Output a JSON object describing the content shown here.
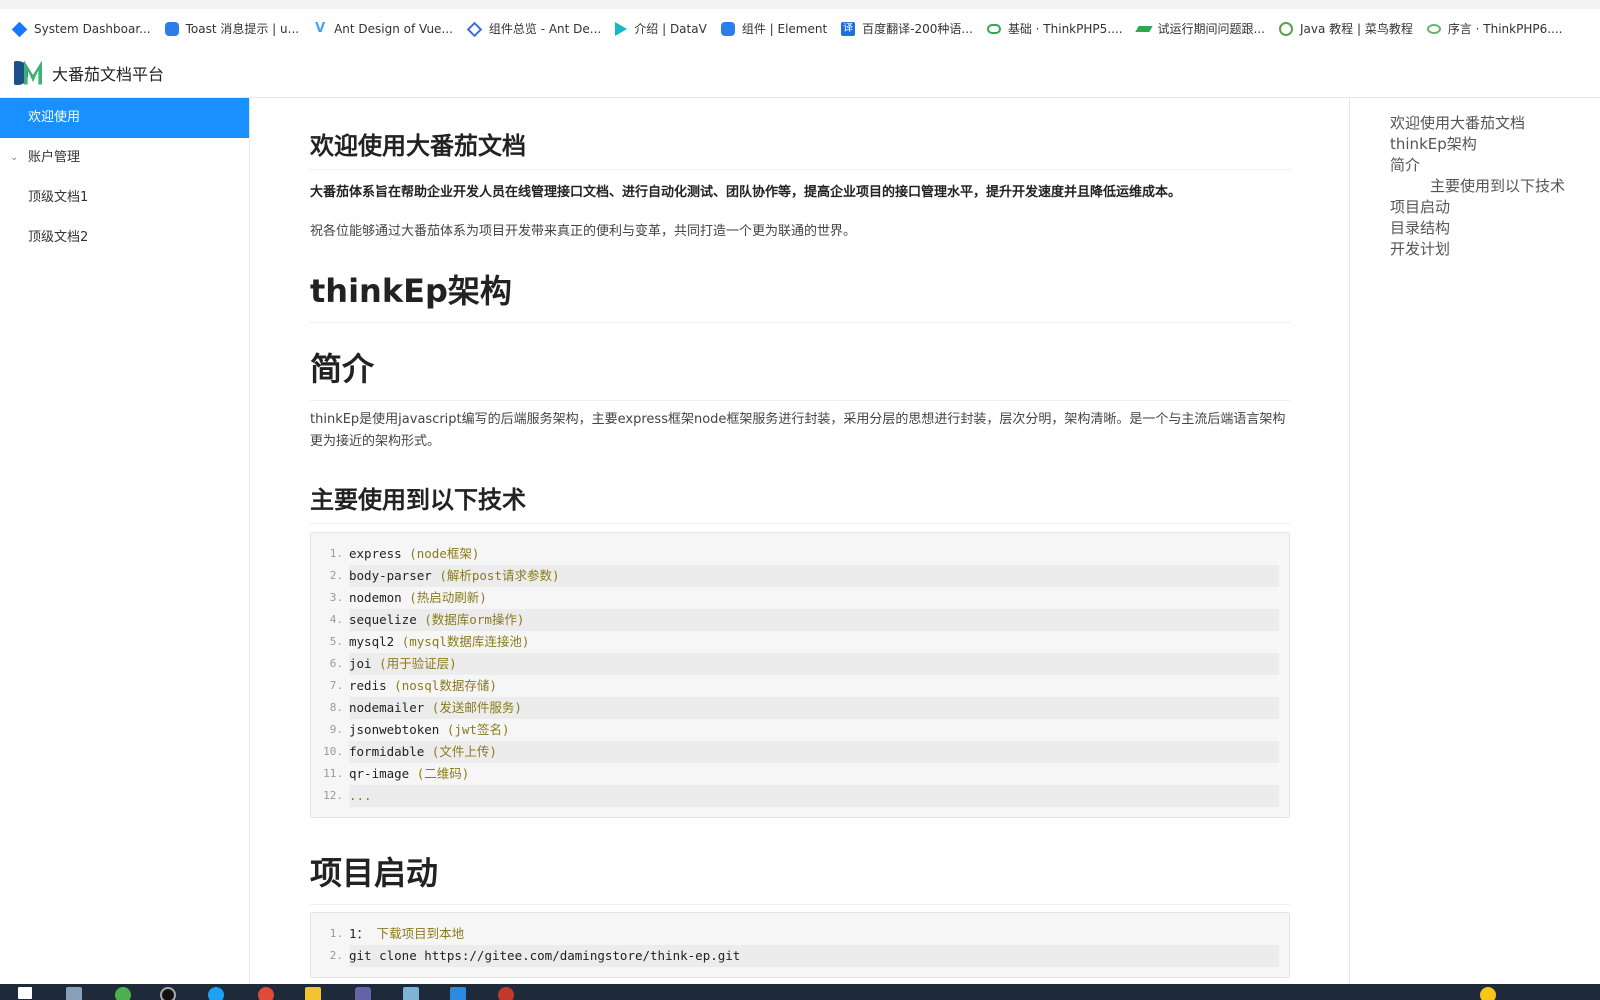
{
  "browser": {
    "bookmarks": [
      {
        "label": "System Dashboar...",
        "icon": "jira-icon"
      },
      {
        "label": "Toast 消息提示 | u...",
        "icon": "cube-icon"
      },
      {
        "label": "Ant Design of Vue...",
        "icon": "vue-icon"
      },
      {
        "label": "组件总览 - Ant De...",
        "icon": "antd-icon"
      },
      {
        "label": "介绍 | DataV",
        "icon": "datav-icon"
      },
      {
        "label": "组件 | Element",
        "icon": "element-icon"
      },
      {
        "label": "百度翻译-200种语...",
        "icon": "baidu-translate-icon"
      },
      {
        "label": "基础 · ThinkPHP5....",
        "icon": "thinkphp-icon"
      },
      {
        "label": "试运行期间问题跟...",
        "icon": "pen-icon"
      },
      {
        "label": "Java 教程 | 菜鸟教程",
        "icon": "runoob-icon"
      },
      {
        "label": "序言 · ThinkPHP6....",
        "icon": "thinkphp-icon"
      }
    ]
  },
  "header": {
    "title": "大番茄文档平台"
  },
  "sidebar": {
    "items": [
      {
        "label": "欢迎使用",
        "active": true
      },
      {
        "label": "账户管理",
        "expandable": true
      },
      {
        "label": "顶级文档1"
      },
      {
        "label": "顶级文档2"
      }
    ]
  },
  "content": {
    "welcome_title": "欢迎使用大番茄文档",
    "welcome_bold": "大番茄体系旨在帮助企业开发人员在线管理接口文档、进行自动化测试、团队协作等，提高企业项目的接口管理水平，提升开发速度并且降低运维成本。",
    "welcome_text": "祝各位能够通过大番茄体系为项目开发带来真正的便利与变革，共同打造一个更为联通的世界。",
    "arch_title": "thinkEp架构",
    "intro_title": "简介",
    "intro_text": "thinkEp是使用javascript编写的后端服务架构，主要express框架node框架服务进行封装，采用分层的思想进行封装，层次分明，架构清晰。是一个与主流后端语言架构更为接近的架构形式。",
    "tech_title": "主要使用到以下技术",
    "tech_lines": [
      {
        "num": "1.",
        "code": "express",
        "comment": "(node框架)"
      },
      {
        "num": "2.",
        "code": "body-parser",
        "comment": "(解析post请求参数)"
      },
      {
        "num": "3.",
        "code": "nodemon",
        "comment": "(热启动刷新)"
      },
      {
        "num": "4.",
        "code": "sequelize",
        "comment": "(数据库orm操作)"
      },
      {
        "num": "5.",
        "code": "mysql2",
        "comment": "(mysql数据库连接池)"
      },
      {
        "num": "6.",
        "code": "joi",
        "comment": "(用于验证层)"
      },
      {
        "num": "7.",
        "code": "redis",
        "comment": "(nosql数据存储)"
      },
      {
        "num": "8.",
        "code": "nodemailer",
        "comment": "(发送邮件服务)"
      },
      {
        "num": "9.",
        "code": "jsonwebtoken",
        "comment": "(jwt签名)"
      },
      {
        "num": "10.",
        "code": "formidable",
        "comment": "(文件上传)"
      },
      {
        "num": "11.",
        "code": "qr-image",
        "comment": "(二维码)"
      },
      {
        "num": "12.",
        "code": "",
        "comment": "..."
      }
    ],
    "start_title": "项目启动",
    "start_lines": [
      {
        "num": "1.",
        "code": "1：",
        "comment": "下载项目到本地"
      },
      {
        "num": "2.",
        "code": "git clone https://gitee.com/damingstore/think-ep.git",
        "comment": ""
      }
    ]
  },
  "toc": {
    "items": [
      {
        "label": "欢迎使用大番茄文档",
        "level": 1
      },
      {
        "label": "thinkEp架构",
        "level": 1
      },
      {
        "label": "简介",
        "level": 1
      },
      {
        "label": "主要使用到以下技术",
        "level": 2
      },
      {
        "label": "项目启动",
        "level": 1
      },
      {
        "label": "目录结构",
        "level": 1
      },
      {
        "label": "开发计划",
        "level": 1
      }
    ]
  },
  "colors": {
    "accent": "#1890ff",
    "code_comment": "#8a7a1f"
  }
}
